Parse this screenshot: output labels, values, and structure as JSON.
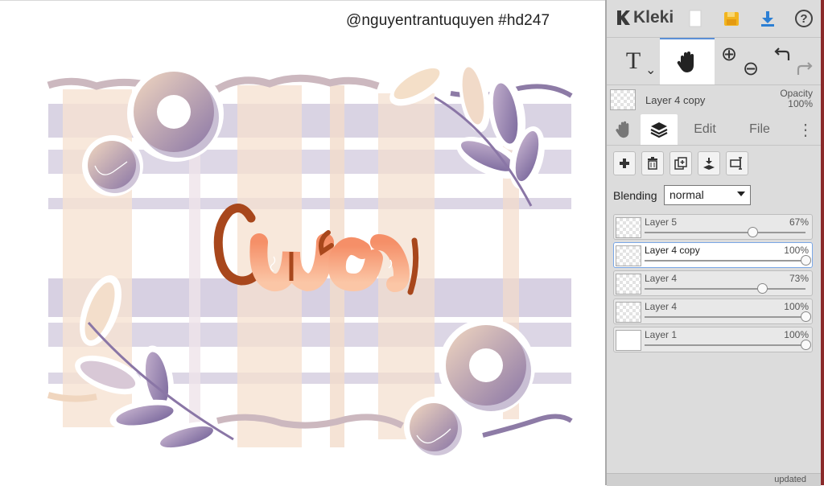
{
  "canvas": {
    "credit": "@nguyentrantuquyen #hd247",
    "lettering": "Cưa"
  },
  "app": {
    "name": "Kleki"
  },
  "toolbar": {
    "icons": [
      "new-image-icon",
      "save-icon",
      "download-icon",
      "help-icon"
    ],
    "help_glyph": "?"
  },
  "tools": {
    "text_glyph": "T",
    "text_caret": "⌄",
    "zoom_in_glyph": "⊕",
    "zoom_out_glyph": "⊖"
  },
  "active_layer": {
    "name": "Layer 4 copy",
    "opacity_label": "Opacity",
    "opacity_value": "100%"
  },
  "tabs": {
    "edit": "Edit",
    "file": "File",
    "more": "⋮"
  },
  "blending": {
    "label": "Blending",
    "value": "normal"
  },
  "layers": [
    {
      "name": "Layer 5",
      "opacity": 67,
      "opacity_label": "67%",
      "selected": false
    },
    {
      "name": "Layer 4 copy",
      "opacity": 100,
      "opacity_label": "100%",
      "selected": true
    },
    {
      "name": "Layer 4",
      "opacity": 73,
      "opacity_label": "73%",
      "selected": false
    },
    {
      "name": "Layer 4",
      "opacity": 100,
      "opacity_label": "100%",
      "selected": false
    },
    {
      "name": "Layer 1",
      "opacity": 100,
      "opacity_label": "100%",
      "selected": false
    }
  ],
  "footer": {
    "updated": "updated"
  },
  "colors": {
    "accent": "#5b8fd6",
    "download": "#2c7fd4",
    "save": "#f2b51f",
    "lettering_dark": "#a8471c",
    "lettering_light": "#f7a274",
    "purple": "#8d7ba6",
    "peach": "#f0d9c4"
  }
}
